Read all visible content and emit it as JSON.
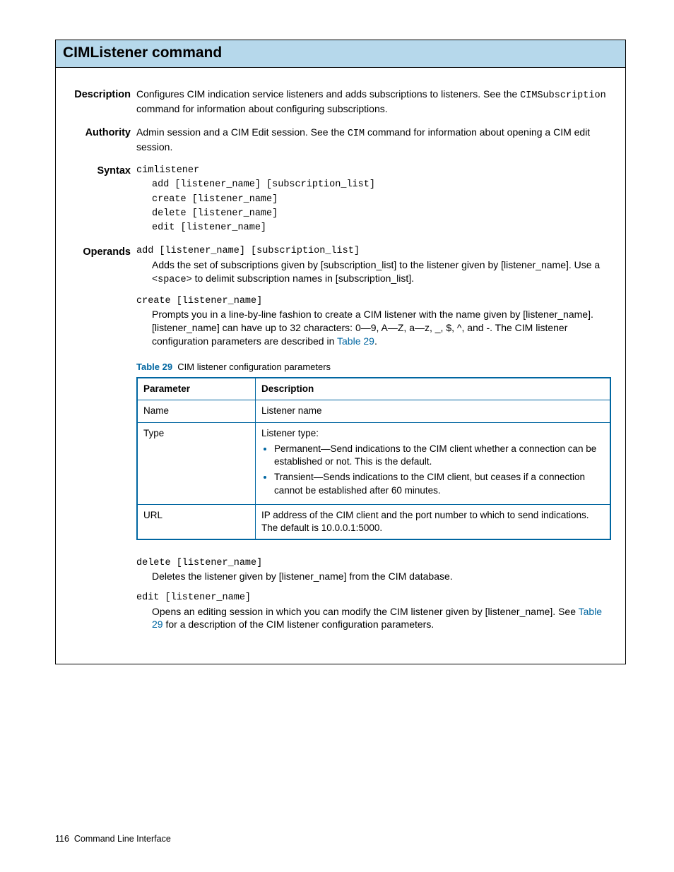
{
  "title": "CIMListener command",
  "sections": {
    "description": {
      "label": "Description",
      "text_part1": "Configures CIM indication service listeners and adds subscriptions to listeners. See the ",
      "code1": "CIMSubscription",
      "text_part2": " command for information about configuring subscriptions."
    },
    "authority": {
      "label": "Authority",
      "text_part1": "Admin session and a CIM Edit session. See the ",
      "code1": "CIM",
      "text_part2": " command for information about opening a CIM edit session."
    },
    "syntax": {
      "label": "Syntax",
      "cmd": "cimlistener",
      "lines": [
        "add [listener_name] [subscription_list]",
        "create [listener_name]",
        "delete [listener_name]",
        "edit [listener_name]"
      ]
    },
    "operands": {
      "label": "Operands",
      "add": {
        "head": "add [listener_name] [subscription_list]",
        "body_part1": "Adds the set of subscriptions given by [subscription_list] to the listener given by [listener_name]. Use a ",
        "code1": "<space>",
        "body_part2": " to delimit subscription names in [subscription_list]."
      },
      "create": {
        "head": "create [listener_name]",
        "body_part1": "Prompts you in a line-by-line fashion to create a CIM listener with the name given by [listener_name]. [listener_name] can have up to 32 characters: 0—9, A—Z, a—z, _, $, ^, and -. The CIM listener configuration parameters are described in ",
        "link1": "Table 29",
        "body_part2": "."
      },
      "delete": {
        "head": "delete [listener_name]",
        "body": "Deletes the listener given by [listener_name] from the CIM database."
      },
      "edit": {
        "head": "edit [listener_name]",
        "body_part1": "Opens an editing session in which you can modify the CIM listener given by [listener_name]. See ",
        "link1": "Table 29",
        "body_part2": " for a description of the CIM listener configuration parameters."
      }
    }
  },
  "table": {
    "caption_label": "Table 29",
    "caption_text": "CIM listener configuration parameters",
    "headers": {
      "param": "Parameter",
      "desc": "Description"
    },
    "rows": {
      "name": {
        "param": "Name",
        "desc": "Listener name"
      },
      "type": {
        "param": "Type",
        "desc_intro": "Listener type:",
        "bullets": [
          "Permanent—Send indications to the CIM client whether a connection can be established or not. This is the default.",
          "Transient—Sends indications to the CIM client, but ceases if a connection cannot be established after 60 minutes."
        ]
      },
      "url": {
        "param": "URL",
        "desc": "IP address of the CIM client and the port number to which to send indications. The default is 10.0.0.1:5000."
      }
    }
  },
  "footer": {
    "page_num": "116",
    "section": "Command Line Interface"
  }
}
